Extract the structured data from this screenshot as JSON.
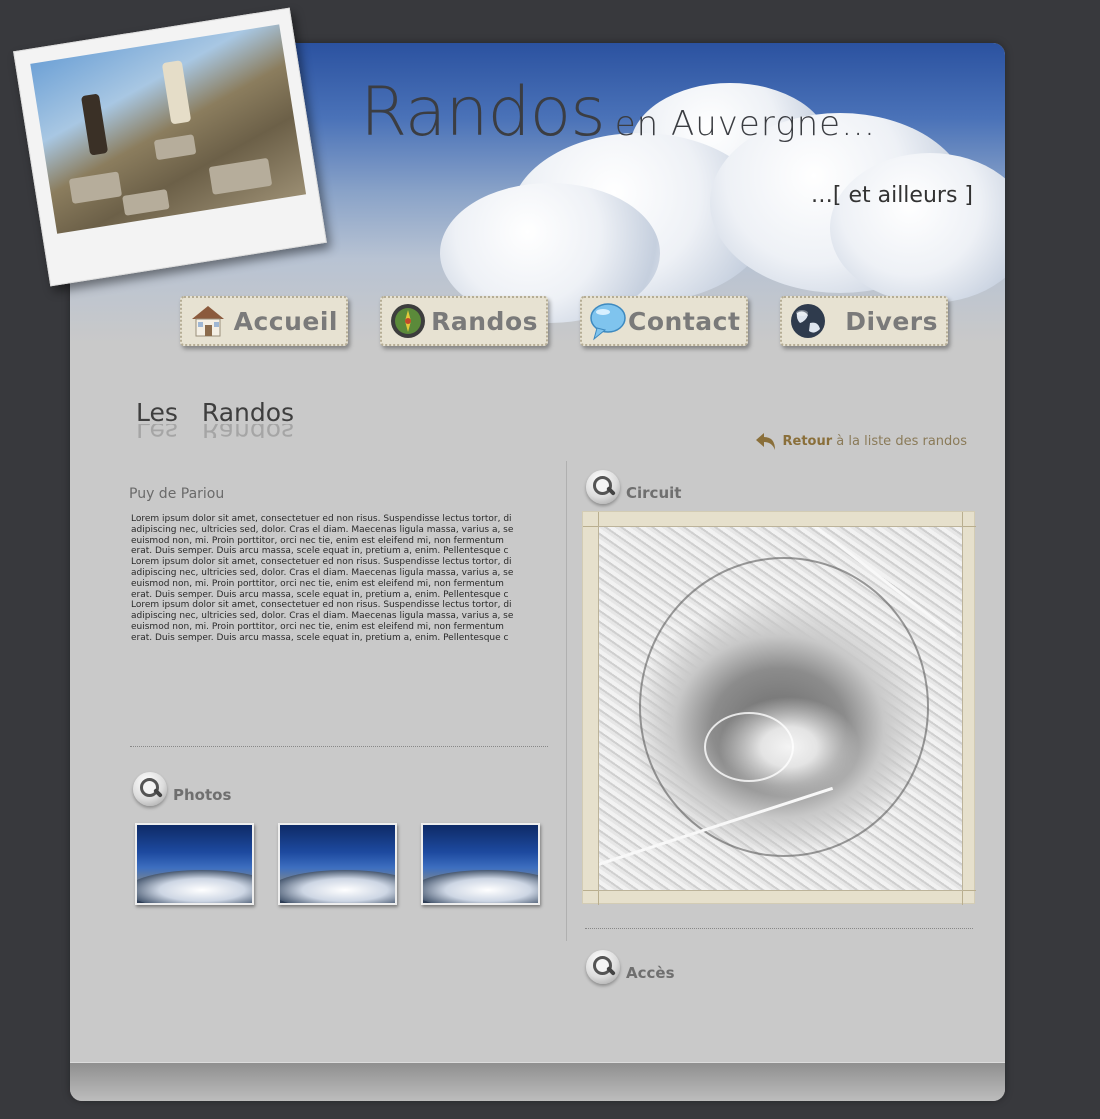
{
  "header": {
    "title_main": "Randos",
    "title_rest": "en Auvergne…",
    "subtitle": "…[ et ailleurs ]"
  },
  "nav": {
    "items": [
      {
        "label": "Accueil",
        "icon": "house-icon"
      },
      {
        "label": "Randos",
        "icon": "compass-icon"
      },
      {
        "label": "Contact",
        "icon": "speech-bubble-icon"
      },
      {
        "label": "Divers",
        "icon": "globe-icon"
      }
    ]
  },
  "main": {
    "title_word1": "Les",
    "title_word2": "Randos",
    "back_strong": "Retour",
    "back_rest": "à la liste des randos",
    "hike_name": "Puy de Pariou",
    "description": "Lorem ipsum dolor sit amet, consectetuer ed non risus. Suspendisse lectus tortor, di adipiscing nec, ultricies sed, dolor. Cras el diam. Maecenas ligula massa, varius a, se euismod non, mi. Proin porttitor, orci nec tie, enim est eleifend mi, non fermentum erat. Duis semper. Duis arcu massa, scele equat in, pretium a, enim. Pellentesque c Lorem ipsum dolor sit amet, consectetuer ed non risus. Suspendisse lectus tortor, di adipiscing nec, ultricies sed, dolor. Cras el diam. Maecenas ligula massa, varius a, se euismod non, mi. Proin porttitor, orci nec tie, enim est eleifend mi, non fermentum erat. Duis semper. Duis arcu massa, scele equat in, pretium a, enim. Pellentesque c Lorem ipsum dolor sit amet, consectetuer ed non risus. Suspendisse lectus tortor, di adipiscing nec, ultricies sed, dolor. Cras el diam. Maecenas ligula massa, varius a, se euismod non, mi. Proin porttitor, orci nec tie, enim est eleifend mi, non fermentum erat. Duis semper. Duis arcu massa, scele equat in, pretium a, enim. Pellentesque c"
  },
  "sections": {
    "photos": "Photos",
    "circuit": "Circuit",
    "acces": "Accès"
  },
  "colors": {
    "background": "#38393d",
    "panel": "#c9c9c9",
    "nav_button": "#e7e2d2",
    "accent_back": "#8a6f3a"
  }
}
